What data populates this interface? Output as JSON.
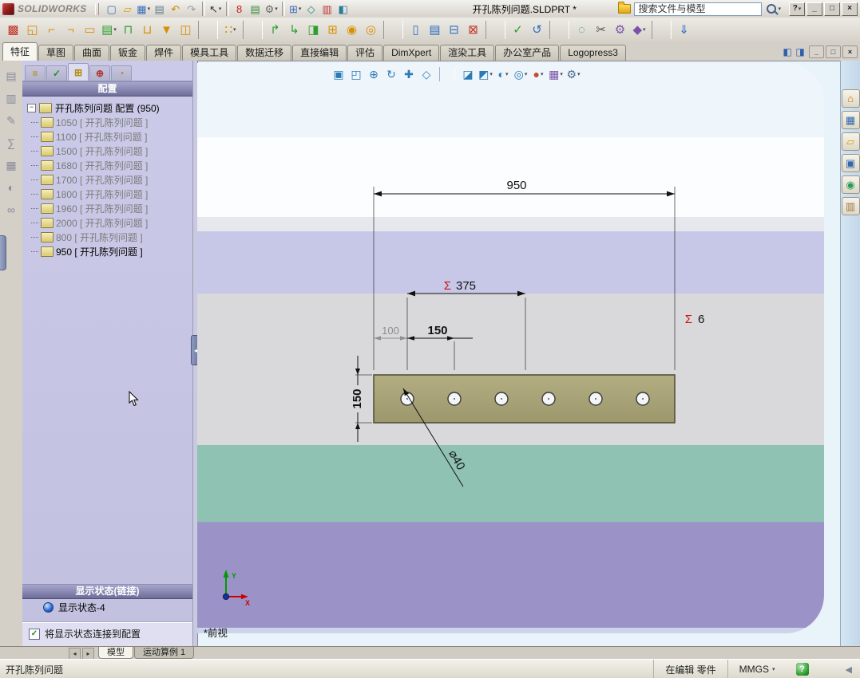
{
  "window": {
    "brand": "SOLIDWORKS",
    "title": "开孔陈列问题.SLDPRT *",
    "search_placeholder": "搜索文件与模型"
  },
  "ui": {
    "collapse_glyph": "−",
    "check_glyph": "✓",
    "splitter_glyph": "◂",
    "scroll_left": "◂",
    "scroll_right": "▸",
    "status_arrow": "◀",
    "help_glyph": "?"
  },
  "titlebar": {
    "icons": [
      {
        "n": "new-document-icon",
        "g": "▢",
        "c": "#3a6fbf"
      },
      {
        "n": "open-document-icon",
        "g": "▱",
        "c": "#d9a400"
      },
      {
        "n": "save-icon",
        "g": "▦",
        "c": "#3a6fbf",
        "d": 1
      },
      {
        "n": "print-icon",
        "g": "▤",
        "c": "#5a7a8a"
      },
      {
        "n": "undo-icon",
        "g": "↶",
        "c": "#c98a00"
      },
      {
        "n": "redo-icon",
        "g": "↷",
        "c": "#9a9a9a"
      },
      {
        "sep": 1
      },
      {
        "n": "select-arrow-icon",
        "g": "↖",
        "c": "#333333",
        "d": 1
      },
      {
        "sep": 1
      },
      {
        "n": "rebuild-icon",
        "g": "8",
        "c": "#cc2222"
      },
      {
        "n": "file-properties-icon",
        "g": "▤",
        "c": "#3a8a3a"
      },
      {
        "n": "options-gear-icon",
        "g": "⚙",
        "c": "#6a6a6a",
        "d": 1
      },
      {
        "sep": 1
      },
      {
        "n": "design-table-icon",
        "g": "⊞",
        "c": "#3a6fbf",
        "d": 1
      },
      {
        "n": "measure-icon",
        "g": "◇",
        "c": "#2a8a8a"
      },
      {
        "n": "color-swatch-icon",
        "g": "▥",
        "c": "#c03030"
      },
      {
        "n": "capture-icon",
        "g": "◧",
        "c": "#2a7a9a"
      }
    ],
    "window_controls": [
      {
        "n": "help-button",
        "g": "?",
        "c": "#222222",
        "d": 1
      },
      {
        "n": "minimize-button",
        "g": "_",
        "c": "#222222"
      },
      {
        "n": "maximize-button",
        "g": "□",
        "c": "#222222"
      },
      {
        "n": "close-button",
        "g": "×",
        "c": "#222222"
      }
    ]
  },
  "toolbar2": {
    "icons": [
      {
        "n": "logopress-home-icon",
        "g": "▩",
        "c": "#c03020"
      },
      {
        "n": "blank-open-icon",
        "g": "◱",
        "c": "#d89000"
      },
      {
        "n": "unbend-icon",
        "g": "⌐",
        "c": "#d89000"
      },
      {
        "n": "rebend-icon",
        "g": "¬",
        "c": "#d89000"
      },
      {
        "n": "flatten-icon",
        "g": "▭",
        "c": "#d89000"
      },
      {
        "n": "strip-layout-icon",
        "g": "▤",
        "c": "#2f9e2f",
        "d": 1
      },
      {
        "n": "die-block-icon",
        "g": "⊓",
        "c": "#2f9e2f"
      },
      {
        "n": "punch-plate-icon",
        "g": "⊔",
        "c": "#d89000"
      },
      {
        "n": "punch-icon",
        "g": "▼",
        "c": "#d89000"
      },
      {
        "n": "tool-set-icon",
        "g": "◫",
        "c": "#d89000"
      },
      {
        "sep": 1
      },
      {
        "n": "pattern-grid-icon",
        "g": "∷",
        "c": "#d89000",
        "d": 1
      },
      {
        "sep": 1
      },
      {
        "n": "bend-up-icon",
        "g": "↱",
        "c": "#2f9e2f"
      },
      {
        "n": "bend-down-icon",
        "g": "↳",
        "c": "#2f9e2f"
      },
      {
        "n": "form-tool-icon",
        "g": "◨",
        "c": "#2f9e2f"
      },
      {
        "n": "insert-part-icon",
        "g": "⊞",
        "c": "#d89000"
      },
      {
        "n": "stamp-icon",
        "g": "◉",
        "c": "#d89000"
      },
      {
        "n": "coin-tool-icon",
        "g": "◎",
        "c": "#d89000"
      },
      {
        "sep": 1
      },
      {
        "n": "clipboard-icon",
        "g": "▯",
        "c": "#2f6fbf"
      },
      {
        "n": "note-icon",
        "g": "▤",
        "c": "#2f6fbf"
      },
      {
        "n": "attach-file-icon",
        "g": "⊟",
        "c": "#2f6fbf"
      },
      {
        "n": "delete-tool-icon",
        "g": "⊠",
        "c": "#c03020"
      },
      {
        "sep": 1
      },
      {
        "n": "check-tool-icon",
        "g": "✓",
        "c": "#2f9e2f"
      },
      {
        "n": "update-tool-icon",
        "g": "↺",
        "c": "#2f6fbf"
      },
      {
        "sep": 1
      },
      {
        "n": "search-tool-icon",
        "g": "◌",
        "c": "#1f8f8f"
      },
      {
        "n": "trim-tool-icon",
        "g": "✂",
        "c": "#555555"
      },
      {
        "n": "gear-tool-icon",
        "g": "⚙",
        "c": "#7a52a8"
      },
      {
        "n": "jewel-tool-icon",
        "g": "◆",
        "c": "#7a52a8",
        "d": 1
      },
      {
        "sep": 1
      },
      {
        "n": "export-icon",
        "g": "⇓",
        "c": "#2f6fbf"
      }
    ]
  },
  "command_tabs": [
    {
      "label": "特征",
      "active": 1
    },
    {
      "label": "草图"
    },
    {
      "label": "曲面"
    },
    {
      "label": "钣金"
    },
    {
      "label": "焊件"
    },
    {
      "label": "模具工具"
    },
    {
      "label": "数据迁移"
    },
    {
      "label": "直接编辑"
    },
    {
      "label": "评估"
    },
    {
      "label": "DimXpert"
    },
    {
      "label": "渲染工具"
    },
    {
      "label": "办公室产品"
    },
    {
      "label": "Logopress3"
    }
  ],
  "tabrow": {
    "pane_icons": [
      {
        "n": "featuremanager-pane-icon",
        "g": "◧",
        "c": "#2f5fae"
      },
      {
        "n": "display-pane-icon",
        "g": "◨",
        "c": "#2f5fae"
      }
    ],
    "window_controls": [
      {
        "n": "doc-minimize-button",
        "g": "_",
        "c": "#222222"
      },
      {
        "n": "doc-restore-button",
        "g": "□",
        "c": "#222222"
      },
      {
        "n": "doc-close-button",
        "g": "×",
        "c": "#222222"
      }
    ]
  },
  "left_strip": {
    "icons": [
      {
        "n": "sensors-icon",
        "g": "▤",
        "c": "#8a8a9a"
      },
      {
        "n": "annotations-icon",
        "g": "▥",
        "c": "#8a8a9a"
      },
      {
        "n": "design-binder-icon",
        "g": "✎",
        "c": "#8a8a9a"
      },
      {
        "n": "equations-icon",
        "g": "∑",
        "c": "#8a8a9a"
      },
      {
        "n": "materials-icon",
        "g": "▦",
        "c": "#8a8a9a"
      },
      {
        "n": "lights-icon",
        "g": "◐",
        "c": "#8a8a9a"
      },
      {
        "n": "link-icon",
        "g": "∞",
        "c": "#8a8a9a"
      }
    ]
  },
  "config_panel": {
    "tabs": [
      {
        "n": "featuremanager-tab-icon",
        "g": "≡",
        "c": "#b08a00"
      },
      {
        "n": "propertymanager-tab-icon",
        "g": "✓",
        "c": "#2a8a2a"
      },
      {
        "n": "configurationmanager-tab-icon",
        "g": "⊞",
        "c": "#b08a00",
        "active": 1
      },
      {
        "n": "dimxpertmanager-tab-icon",
        "g": "⊕",
        "c": "#b03030"
      },
      {
        "n": "displaymanager-tab-icon",
        "g": "◔",
        "c": "#d07020"
      }
    ],
    "header": "配置",
    "root_label": "开孔陈列问题 配置 (950)",
    "items": [
      {
        "label": "1050 [ 开孔陈列问题 ]"
      },
      {
        "label": "1100 [ 开孔陈列问题 ]"
      },
      {
        "label": "1500 [ 开孔陈列问题 ]"
      },
      {
        "label": "1680 [ 开孔陈列问题 ]"
      },
      {
        "label": "1700 [ 开孔陈列问题 ]"
      },
      {
        "label": "1800 [ 开孔陈列问题 ]"
      },
      {
        "label": "1960 [ 开孔陈列问题 ]"
      },
      {
        "label": "2000 [ 开孔陈列问题 ]"
      },
      {
        "label": "800 [ 开孔陈列问题 ]"
      },
      {
        "label": "950 [ 开孔陈列问题 ]",
        "active": 1
      }
    ],
    "display_header": "显示状态(链接)",
    "display_state": "显示状态-4",
    "link_label": "将显示状态连接到配置"
  },
  "viewport": {
    "hud": [
      {
        "n": "zoom-fit-icon",
        "g": "▣",
        "c": "#2a7ab5"
      },
      {
        "n": "zoom-area-icon",
        "g": "◰",
        "c": "#2a7ab5"
      },
      {
        "n": "zoom-inout-icon",
        "g": "⊕",
        "c": "#2a7ab5"
      },
      {
        "n": "rotate-view-icon",
        "g": "↻",
        "c": "#2a7ab5"
      },
      {
        "n": "pan-icon",
        "g": "✚",
        "c": "#2a7ab5"
      },
      {
        "n": "3d-drawing-view-icon",
        "g": "◇",
        "c": "#2a7ab5"
      },
      {
        "sep": 1
      },
      {
        "n": "section-view-icon",
        "g": "◪",
        "c": "#2a7ab5"
      },
      {
        "n": "view-orientation-icon",
        "g": "◩",
        "c": "#2a7ab5",
        "d": 1
      },
      {
        "n": "display-style-icon",
        "g": "◐",
        "c": "#2a7ab5",
        "d": 1
      },
      {
        "n": "hide-show-icon",
        "g": "◎",
        "c": "#2a7ab5",
        "d": 1
      },
      {
        "n": "edit-appearance-icon",
        "g": "●",
        "c": "#c25030",
        "d": 1
      },
      {
        "n": "apply-scene-icon",
        "g": "▦",
        "c": "#7a52a8",
        "d": 1
      },
      {
        "n": "view-settings-icon",
        "g": "⚙",
        "c": "#4a6a8a",
        "d": 1
      }
    ],
    "view_label": "*前视",
    "doc_tabs": [
      {
        "label": "模型",
        "active": 1
      },
      {
        "label": "运动算例 1"
      }
    ]
  },
  "right_strip": {
    "icons": [
      {
        "n": "home-tab-icon",
        "g": "⌂",
        "c": "#c87800"
      },
      {
        "n": "design-library-tab-icon",
        "g": "▦",
        "c": "#3068b0"
      },
      {
        "n": "file-explorer-tab-icon",
        "g": "▱",
        "c": "#d8a000"
      },
      {
        "n": "view-palette-tab-icon",
        "g": "▣",
        "c": "#3068b0"
      },
      {
        "n": "appearances-tab-icon",
        "g": "◉",
        "c": "#2a9a5a"
      },
      {
        "n": "custom-properties-tab-icon",
        "g": "▥",
        "c": "#a07848"
      }
    ]
  },
  "drawing": {
    "width_dim": "950",
    "sum_symbol": "Σ",
    "sum_value": "375",
    "ref_dim": "100",
    "pitch_dim": "150",
    "height_dim": "150",
    "hole_dia": "⌀40",
    "instance_sigma": "Σ",
    "instance_count": "6",
    "axis_x": "X",
    "axis_y": "Y"
  },
  "statusbar": {
    "document": "开孔陈列问题",
    "editing_status": "在编辑 零件",
    "units": "MMGS"
  }
}
